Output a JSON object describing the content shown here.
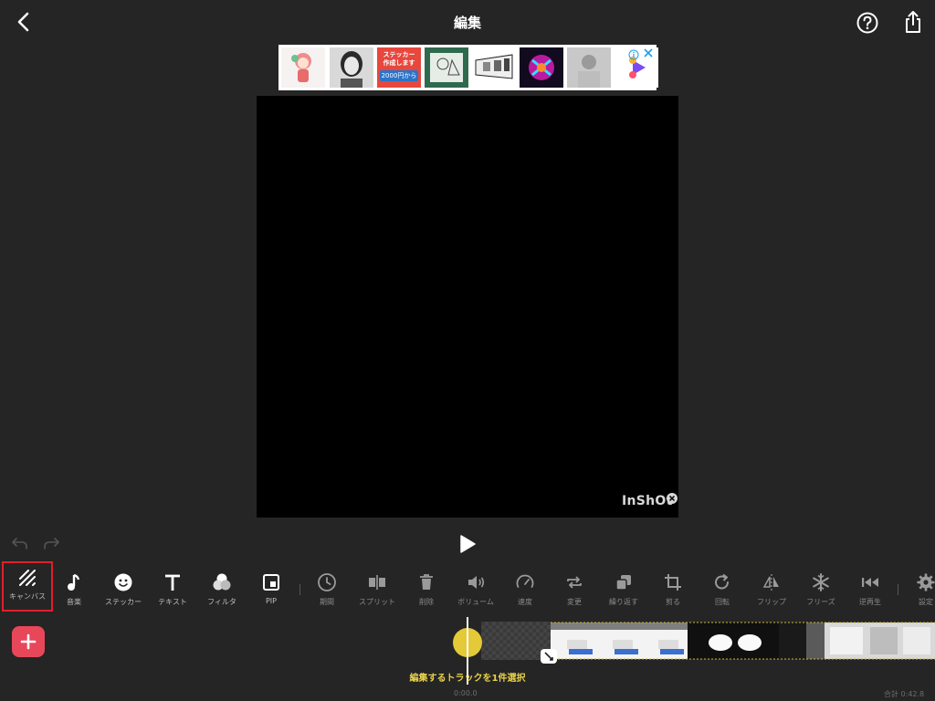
{
  "header": {
    "title": "編集",
    "back_icon": "chevron-left-icon",
    "help_icon": "question-circle-icon",
    "share_icon": "share-icon"
  },
  "ad": {
    "sticker_line1": "ステッカー",
    "sticker_line2": "作成します",
    "sticker_price": "2000円から",
    "info_icon": "info-icon",
    "close_icon": "close-icon"
  },
  "preview": {
    "watermark": "InShOt",
    "watermark_close_icon": "close-circle-icon"
  },
  "controls": {
    "undo_icon": "undo-icon",
    "redo_icon": "redo-icon",
    "play_icon": "play-icon"
  },
  "toolbar": {
    "items": [
      {
        "label": "キャンバス",
        "icon": "canvas-icon",
        "selected": true
      },
      {
        "label": "音楽",
        "icon": "music-note-icon"
      },
      {
        "label": "ステッカー",
        "icon": "smiley-icon"
      },
      {
        "label": "テキスト",
        "icon": "text-icon"
      },
      {
        "label": "フィルタ",
        "icon": "filter-icon"
      },
      {
        "label": "PIP",
        "icon": "pip-icon"
      },
      {
        "label": "期間",
        "icon": "clock-icon"
      },
      {
        "label": "スプリット",
        "icon": "split-icon"
      },
      {
        "label": "削除",
        "icon": "trash-icon"
      },
      {
        "label": "ボリューム",
        "icon": "volume-icon"
      },
      {
        "label": "速度",
        "icon": "speedometer-icon"
      },
      {
        "label": "変更",
        "icon": "replace-icon"
      },
      {
        "label": "繰り返す",
        "icon": "duplicate-icon"
      },
      {
        "label": "剪る",
        "icon": "crop-icon"
      },
      {
        "label": "回転",
        "icon": "rotate-icon"
      },
      {
        "label": "フリップ",
        "icon": "flip-icon"
      },
      {
        "label": "フリーズ",
        "icon": "snowflake-icon"
      },
      {
        "label": "逆再生",
        "icon": "reverse-icon"
      },
      {
        "label": "設定",
        "icon": "gear-icon"
      }
    ]
  },
  "timeline": {
    "add_icon": "plus-icon",
    "hint": "編集するトラックを1件選択",
    "current_time": "0:00.0",
    "total_time": "合計 0:42.8"
  },
  "colors": {
    "background": "#252525",
    "accent_red": "#e8475a",
    "selection_border": "#e0202a",
    "playhead_knob": "#e4c938",
    "hint_text": "#e8d24a"
  }
}
